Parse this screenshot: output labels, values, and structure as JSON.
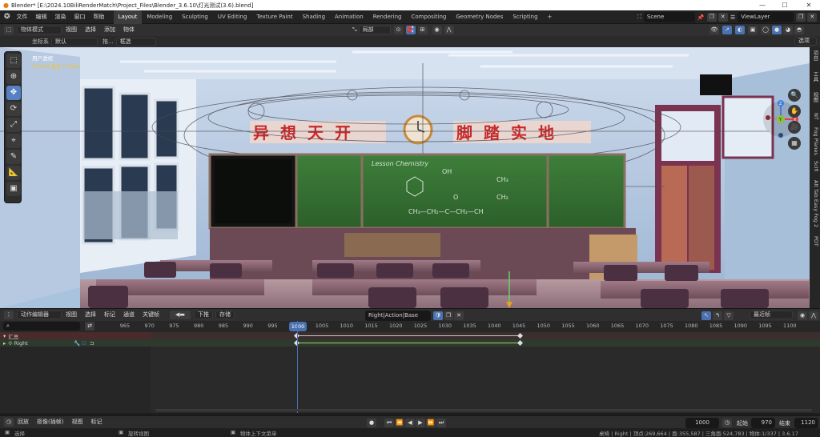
{
  "titlebar": {
    "title": "Blender* [E:\\2024.10BiliRenderMatch\\Project_Files\\Blender_3.6.10\\灯光测试(3.6).blend]",
    "minimize": "—",
    "maximize": "☐",
    "close": "✕"
  },
  "menu": [
    "文件",
    "编辑",
    "渲染",
    "窗口",
    "帮助"
  ],
  "workspaces": [
    "Layout",
    "Modeling",
    "Sculpting",
    "UV Editing",
    "Texture Paint",
    "Shading",
    "Animation",
    "Rendering",
    "Compositing",
    "Geometry Nodes",
    "Scripting",
    "+"
  ],
  "scene": {
    "label": "Scene",
    "view_layer": "ViewLayer"
  },
  "header3d": {
    "mode": "物体模式",
    "menus": [
      "视图",
      "选择",
      "添加",
      "物体"
    ],
    "transform_orientation": "局部",
    "coord_label": "坐标系",
    "coord_value": "默认",
    "drag_label": "拖...",
    "drag_value": "框选",
    "options": "选项"
  },
  "viewport": {
    "overlay_title": "用户透视",
    "overlay_subtitle": "(1000) 集合 | Right",
    "banner_left": "异想天开",
    "banner_right": "脚踏实地",
    "board_title": "Lesson Chemistry",
    "formula_oh": "OH",
    "formula_ch3": "CH₃",
    "formula_ch2": "CH₂",
    "formula_o": "O",
    "formula_chain": "CH₃—CH₂—C—CH₂—CH"
  },
  "npanel_tabs": [
    "项目",
    "工具",
    "视图",
    "NT",
    "Fog Planes",
    "Scifi",
    "Alt Tab Easy Fog 2",
    "PDT"
  ],
  "action_header": {
    "editor": "动作编辑器",
    "menus": [
      "视图",
      "选择",
      "标记",
      "通道",
      "关键帧"
    ],
    "push_down": "下推",
    "stash": "存储",
    "action_name": "Right|Action|Base Layer",
    "nearest": "最近帧"
  },
  "timeline": {
    "current_frame": "1000",
    "ticks": [
      "965",
      "970",
      "975",
      "980",
      "985",
      "990",
      "995",
      "1000",
      "1005",
      "1010",
      "1015",
      "1020",
      "1025",
      "1030",
      "1035",
      "1040",
      "1045",
      "1050",
      "1055",
      "1060",
      "1065",
      "1070",
      "1075",
      "1080",
      "1085",
      "1090",
      "1095",
      "1100"
    ]
  },
  "channels": {
    "summary": "汇总",
    "object": "Right"
  },
  "playback": {
    "menus": [
      "回放",
      "抠像(插帧)",
      "视图",
      "标记"
    ],
    "frame": "1000",
    "start_label": "起始",
    "start": "970",
    "end_label": "结束",
    "end": "1120"
  },
  "status": {
    "left1": "选择",
    "left2": "旋转视图",
    "left3": "物体上下文菜单",
    "right": "桌椅 | Right | 顶点:269,664 | 面:355,587 | 三角面:524,783 | 物体:1/337 | 3.6.17"
  },
  "colors": {
    "accent": "#4a72b0",
    "keyframe_line": "#9bd06a",
    "playhead": "#4a72b0",
    "summary_row": "#4a2a2a"
  }
}
